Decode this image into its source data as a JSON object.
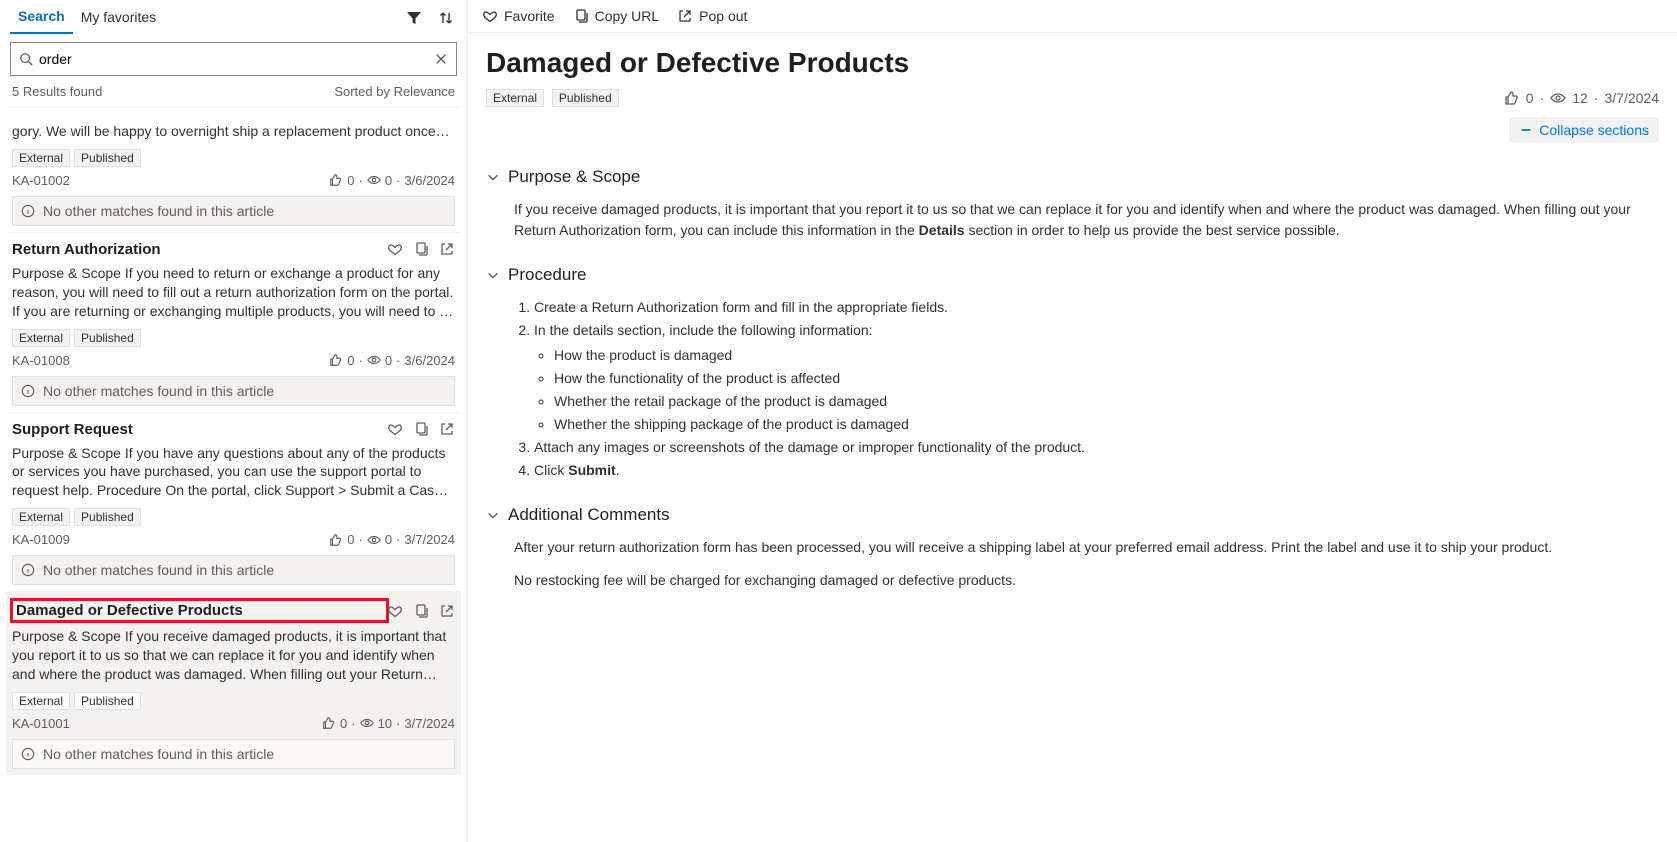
{
  "tabs": {
    "search": "Search",
    "favorites": "My favorites"
  },
  "search": {
    "value": "order"
  },
  "resultCount": "5 Results found",
  "sortedBy": "Sorted by Relevance",
  "noMatches": "No other matches found in this article",
  "results": [
    {
      "title": "",
      "snippet": "gory. We will be happy to overnight ship a replacement product once we…",
      "badges": [
        "External",
        "Published"
      ],
      "id": "KA-01002",
      "likes": "0",
      "views": "0",
      "date": "3/6/2024",
      "short": true
    },
    {
      "title": "Return Authorization",
      "snippet": "Purpose & Scope If you need to return or exchange a product for any reason, you will need to fill out a return authorization form on the portal. If you are returning or exchanging multiple products, you will need to fill out…",
      "badges": [
        "External",
        "Published"
      ],
      "id": "KA-01008",
      "likes": "0",
      "views": "0",
      "date": "3/6/2024"
    },
    {
      "title": "Support Request",
      "snippet": "Purpose & Scope If you have any questions about any of the products or services you have purchased, you can use the support portal to request help. Procedure On the portal, click Support > Submit a Case. Fill in your n…",
      "badges": [
        "External",
        "Published"
      ],
      "id": "KA-01009",
      "likes": "0",
      "views": "0",
      "date": "3/7/2024"
    },
    {
      "title": "Damaged or Defective Products",
      "snippet": "Purpose & Scope If you receive damaged products, it is important that you report it to us so that we can replace it for you and identify when and where the product was damaged. When filling out your Return Authorizat…",
      "badges": [
        "External",
        "Published"
      ],
      "id": "KA-01001",
      "likes": "0",
      "views": "10",
      "date": "3/7/2024",
      "selected": true,
      "highlight": true
    }
  ],
  "topbar": {
    "favorite": "Favorite",
    "copyUrl": "Copy URL",
    "popOut": "Pop out"
  },
  "article": {
    "title": "Damaged or Defective Products",
    "badges": [
      "External",
      "Published"
    ],
    "likes": "0",
    "views": "12",
    "date": "3/7/2024",
    "collapse": "Collapse sections",
    "sections": {
      "purpose": {
        "title": "Purpose & Scope",
        "body_pre": "If you receive damaged products, it is important that you report it to us so that we can replace it for you and identify when and where the product was damaged. When filling out your Return Authorization form, you can include this information in the ",
        "body_bold": "Details",
        "body_post": " section in order to help us provide the best service possible."
      },
      "procedure": {
        "title": "Procedure",
        "ol1": "Create a Return Authorization form and fill in the appropriate fields.",
        "ol2": "In the details section, include the following information:",
        "ul": [
          "How the product is damaged",
          "How the functionality of the product is affected",
          "Whether the retail package of the product is damaged",
          "Whether the shipping package of the product is damaged"
        ],
        "ol3": "Attach any images or screenshots of the damage or improper functionality of the product.",
        "ol4a": "Click ",
        "ol4b": "Submit",
        "ol4c": "."
      },
      "comments": {
        "title": "Additional Comments",
        "p1": "After your return authorization form has been processed, you will receive a shipping label at your preferred email address. Print the label and use it to ship your product.",
        "p2": "No restocking fee will be charged for exchanging damaged or defective products."
      }
    }
  }
}
